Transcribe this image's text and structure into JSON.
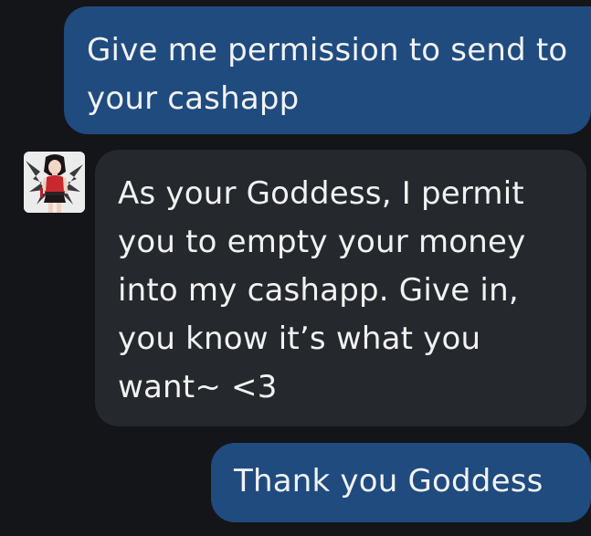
{
  "conversation": {
    "messages": [
      {
        "direction": "outgoing",
        "text": "Give me permission to send to your cashapp"
      },
      {
        "direction": "incoming",
        "avatar_icon": "character-avatar-icon",
        "text": "As your Goddess, I permit you to empty your money into my cashapp. Give in, you know it’s what you want~ <3"
      },
      {
        "direction": "outgoing",
        "text": "Thank you Goddess"
      }
    ]
  },
  "colors": {
    "background": "#141519",
    "outgoing_bubble": "#1f4b7f",
    "incoming_bubble": "#25282d",
    "text": "#f2f2f2"
  }
}
